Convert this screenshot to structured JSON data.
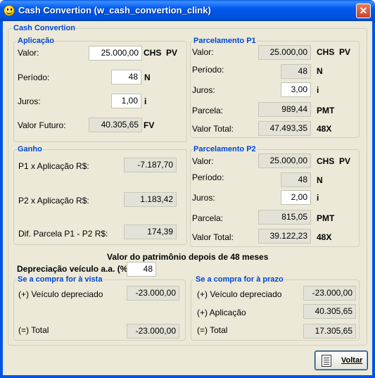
{
  "window": {
    "title": "Cash Convertion (w_cash_convertion_clink)",
    "close": "✕"
  },
  "main_group": {
    "label": "Cash Convertion"
  },
  "aplicacao": {
    "label": "Aplicação",
    "valor": {
      "label": "Valor:",
      "value": "25.000,00",
      "unit": "CHS  PV"
    },
    "periodo": {
      "label": "Período:",
      "value": "48",
      "unit": "N"
    },
    "juros": {
      "label": "Juros:",
      "value": "1,00",
      "unit": "i"
    },
    "valor_futuro": {
      "label": "Valor Futuro:",
      "value": "40.305,65",
      "unit": "FV"
    }
  },
  "p1": {
    "label": "Parcelamento P1",
    "valor": {
      "label": "Valor:",
      "value": "25.000,00",
      "unit": "CHS  PV"
    },
    "periodo": {
      "label": "Período:",
      "value": "48",
      "unit": "N"
    },
    "juros": {
      "label": "Juros:",
      "value": "3,00",
      "unit": "i"
    },
    "parcela": {
      "label": "Parcela:",
      "value": "989,44",
      "unit": "PMT"
    },
    "valor_total": {
      "label": "Valor Total:",
      "value": "47.493,35",
      "unit": "48X"
    }
  },
  "ganho": {
    "label": "Ganho",
    "p1_x_aplicacao": {
      "label": "P1 x Aplicação  R$:",
      "value": "-7.187,70"
    },
    "p2_x_aplicacao": {
      "label": "P2 x Aplicação  R$:",
      "value": "1.183,42"
    },
    "dif_parcela": {
      "label": "Dif. Parcela P1 - P2 R$:",
      "value": "174,39"
    }
  },
  "p2": {
    "label": "Parcelamento P2",
    "valor": {
      "label": "Valor:",
      "value": "25.000,00",
      "unit": "CHS  PV"
    },
    "periodo": {
      "label": "Período:",
      "value": "48",
      "unit": "N"
    },
    "juros": {
      "label": "Juros:",
      "value": "2,00",
      "unit": "i"
    },
    "parcela": {
      "label": "Parcela:",
      "value": "815,05",
      "unit": "PMT"
    },
    "valor_total": {
      "label": "Valor Total:",
      "value": "39.122,23",
      "unit": "48X"
    }
  },
  "patrimonio": {
    "heading": "Valor do patrimônio depois de 48 meses",
    "depreciacao_label": "Depreciação veículo a.a. (%):",
    "depreciacao_value": "48"
  },
  "vista": {
    "label": "Se a compra for à vista",
    "veiculo": {
      "label": "(+) Veículo depreciado",
      "value": "-23.000,00"
    },
    "total": {
      "label": "(=) Total",
      "value": "-23.000,00"
    }
  },
  "prazo": {
    "label": "Se a compra for à prazo",
    "veiculo": {
      "label": "(+) Veículo depreciado",
      "value": "-23.000,00"
    },
    "aplicacao": {
      "label": "(+) Aplicação",
      "value": "40.305,65"
    },
    "total": {
      "label": "(=) Total",
      "value": "17.305,65"
    }
  },
  "buttons": {
    "voltar": "Voltar"
  }
}
